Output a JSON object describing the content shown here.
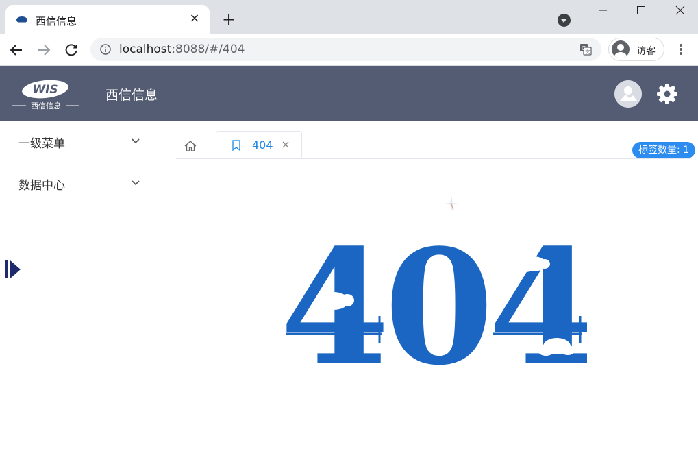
{
  "browser": {
    "tab_title": "西信信息",
    "tab_close": "×",
    "new_tab": "+",
    "url_host": "localhost",
    "url_rest": ":8088/#/404",
    "profile_label": "访客",
    "icons": [
      "favicon-icon",
      "close-icon",
      "plus-icon",
      "tab-search-icon",
      "minimize-icon",
      "maximize-icon",
      "window-close-icon",
      "back-icon",
      "forward-icon",
      "reload-icon",
      "info-icon",
      "translate-icon",
      "profile-icon",
      "kebab-menu-icon"
    ]
  },
  "header": {
    "logo_text": "WIS",
    "logo_subtext": "西信信息",
    "title": "西信信息",
    "icons": [
      "user-avatar-icon",
      "settings-gear-icon"
    ],
    "bg_color": "#535c72"
  },
  "sidebar": {
    "items": [
      {
        "label": "一级菜单"
      },
      {
        "label": "数据中心"
      }
    ],
    "icons": [
      "chevron-down-icon",
      "collapse-toggle-icon"
    ]
  },
  "tabs": {
    "active_label": "404",
    "tag_count_label": "标签数量: 1",
    "icons": [
      "home-icon",
      "bookmark-icon",
      "close-icon"
    ],
    "accent_color": "#1e88e5"
  },
  "error_page": {
    "code": "404",
    "color": "#1a66c2"
  }
}
